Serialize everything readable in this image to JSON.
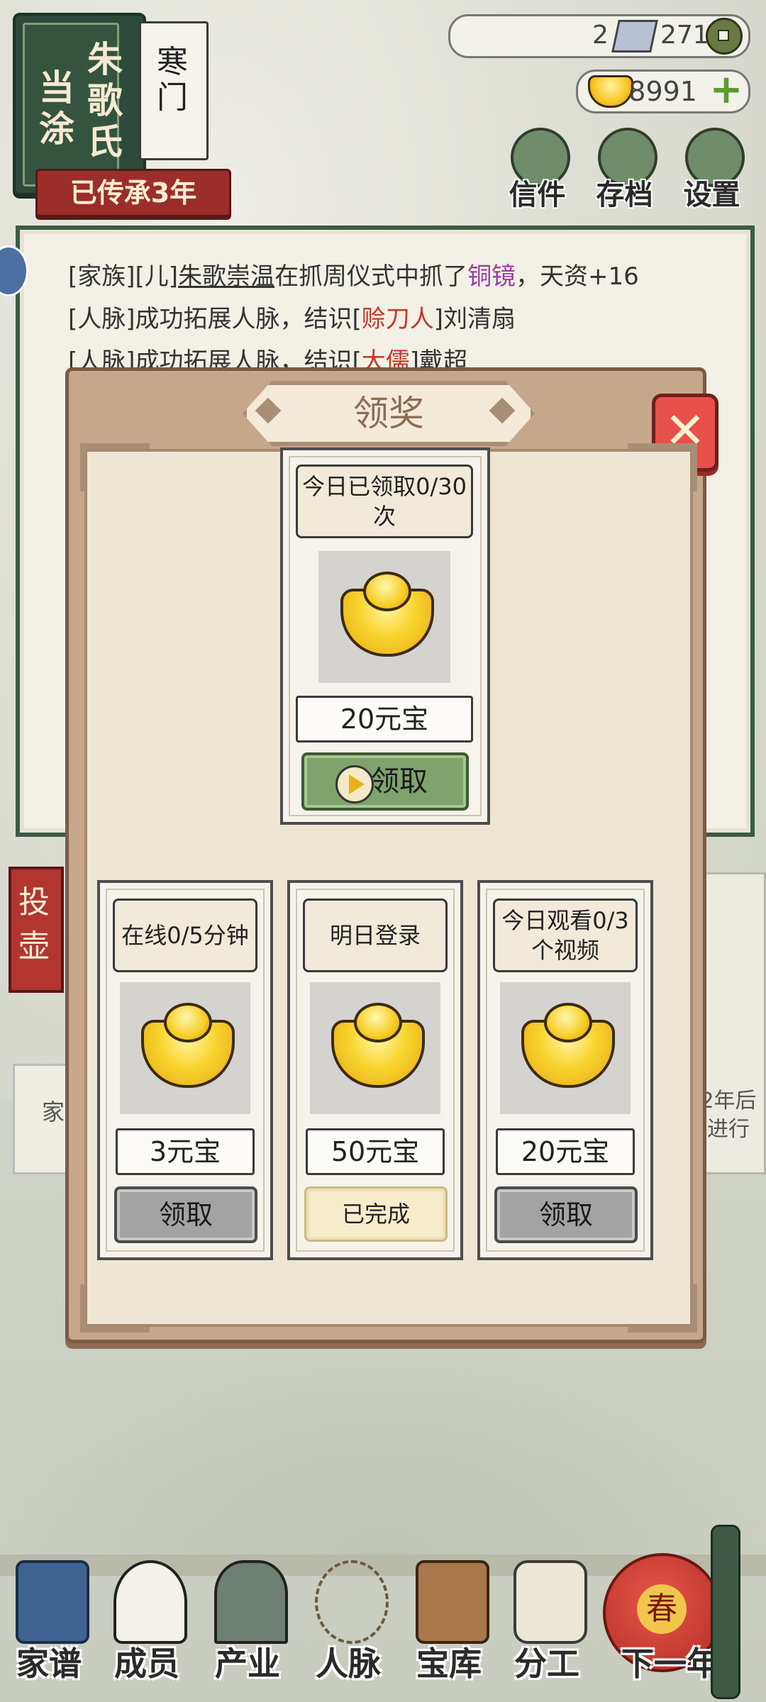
{
  "header": {
    "clan_name_left": "当涂",
    "clan_name_right": "朱歌氏",
    "rank": "寒门",
    "banner": "已传承3年",
    "tickets": "2",
    "coins": "271",
    "gold": "8991",
    "buttons": [
      {
        "label": "信件",
        "icon": "letter-icon"
      },
      {
        "label": "存档",
        "icon": "save-icon"
      },
      {
        "label": "设置",
        "icon": "gear-icon"
      }
    ]
  },
  "log": {
    "line1": {
      "a": "[家族][儿]",
      "b": "朱歌崇温",
      "c": "在抓周仪式中抓了",
      "d": "铜镜",
      "e": "，天资+16"
    },
    "line2": {
      "a": "[人脉]成功拓展人脉，结识[",
      "b": "赊刀人",
      "c": "]刘清扇"
    },
    "line3": {
      "a": "[人脉]成功拓展人脉，结识[",
      "b": "大儒",
      "c": "]戴超"
    }
  },
  "side": {
    "red_sign": "投壶",
    "left_card": "家",
    "right_card": "2年后进行"
  },
  "dialog": {
    "title": "领奖",
    "close": "✕",
    "top_card": {
      "label": "今日已领取0/30次",
      "amount": "20元宝",
      "button": "领取"
    },
    "cards": [
      {
        "label": "在线0/5分钟",
        "amount": "3元宝",
        "button": "领取",
        "state": "available"
      },
      {
        "label": "明日登录",
        "amount": "50元宝",
        "button": "已完成",
        "state": "done"
      },
      {
        "label": "今日观看0/3个视频",
        "amount": "20元宝",
        "button": "领取",
        "state": "available"
      }
    ]
  },
  "nav": [
    {
      "label": "家谱",
      "icon": "genealogy-book-icon"
    },
    {
      "label": "成员",
      "icon": "member-icon"
    },
    {
      "label": "产业",
      "icon": "building-icon"
    },
    {
      "label": "人脉",
      "icon": "network-icon"
    },
    {
      "label": "宝库",
      "icon": "treasure-box-icon"
    },
    {
      "label": "分工",
      "icon": "scroll-icon"
    },
    {
      "label": "下一年",
      "icon": "lantern-icon",
      "badge": "春"
    }
  ],
  "colors": {
    "accent_green": "#7fa36d",
    "accent_red": "#b2352f",
    "gold": "#f7c520"
  }
}
